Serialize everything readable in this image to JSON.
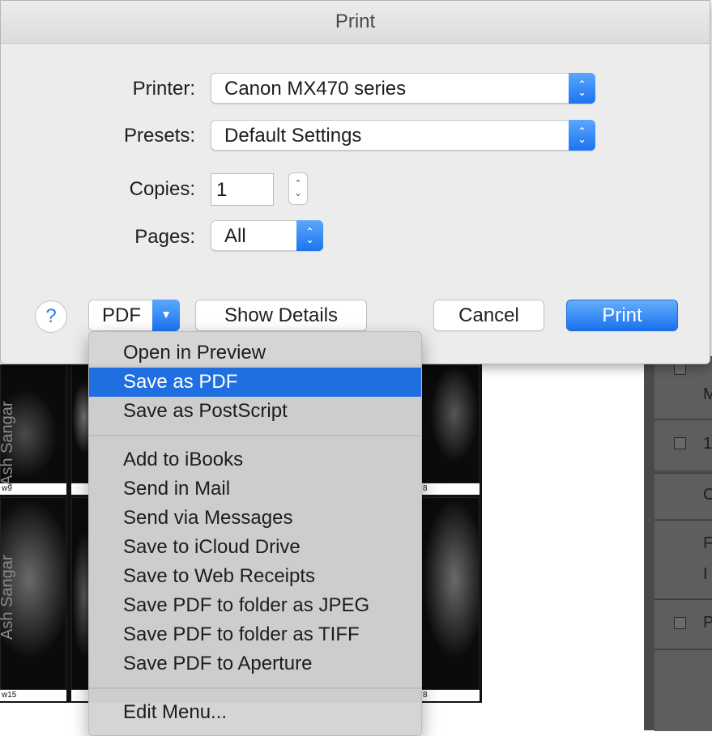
{
  "dialog": {
    "title": "Print",
    "printer_label": "Printer:",
    "printer_value": "Canon MX470 series",
    "presets_label": "Presets:",
    "presets_value": "Default Settings",
    "copies_label": "Copies:",
    "copies_value": "1",
    "pages_label": "Pages:",
    "pages_value": "All",
    "help_symbol": "?",
    "pdf_label": "PDF",
    "show_details_label": "Show Details",
    "cancel_label": "Cancel",
    "print_label": "Print"
  },
  "pdf_menu": {
    "group1": [
      "Open in Preview",
      "Save as PDF",
      "Save as PostScript"
    ],
    "selected": "Save as PDF",
    "group2": [
      "Add to iBooks",
      "Send in Mail",
      "Send via Messages",
      "Save to iCloud Drive",
      "Save to Web Receipts",
      "Save PDF to folder as JPEG",
      "Save PDF to folder as TIFF",
      "Save PDF to Aperture"
    ],
    "group3": [
      "Edit Menu..."
    ]
  },
  "background": {
    "thumb_captions": [
      "w9",
      "8",
      "w15",
      "8"
    ],
    "vertical_texts": [
      "Ash Sangar",
      "Ash Sangar"
    ],
    "panel_letters": [
      "M",
      "1",
      "C",
      "F",
      "I",
      "P"
    ]
  },
  "icons": {
    "help": "help-icon",
    "popup_stepper": "up-down-chevron-icon",
    "pdf_arrow": "chevron-down-icon"
  },
  "colors": {
    "accent": "#1f6fe0",
    "sheet_bg": "#ececec",
    "menu_bg": "#d4d4d4"
  }
}
